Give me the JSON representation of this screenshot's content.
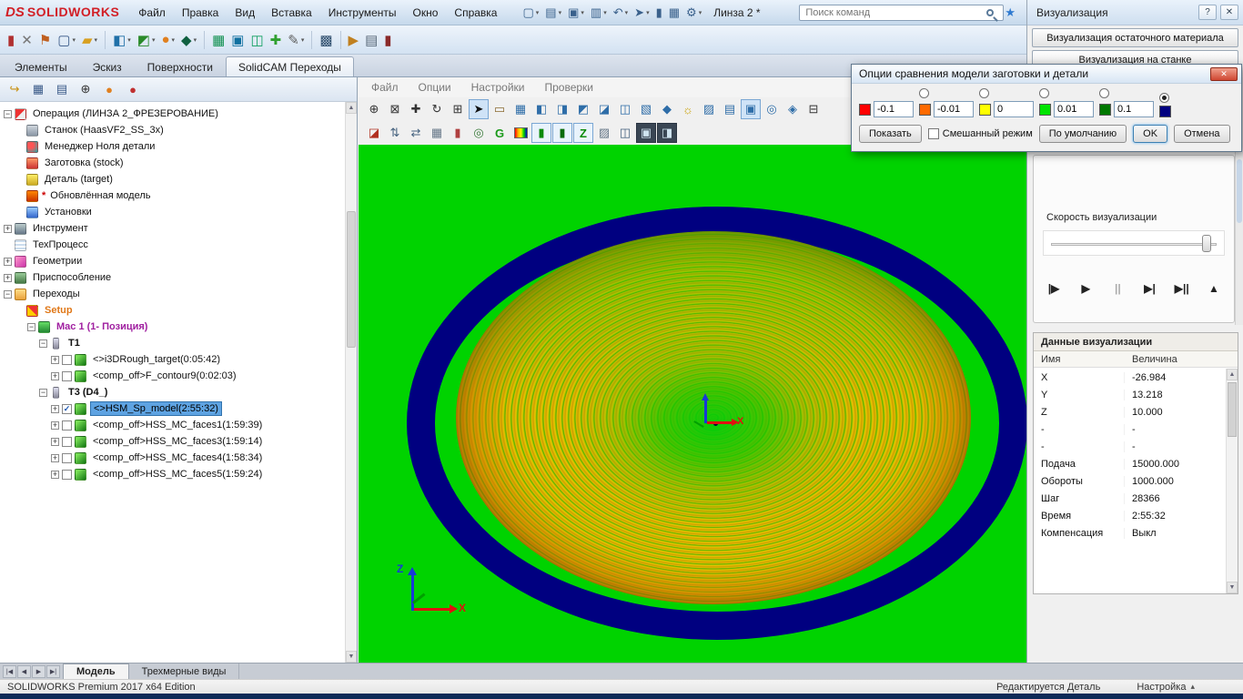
{
  "titlebar": {
    "logo_ds": "DS",
    "logo_text": "SOLIDWORKS",
    "doc_title": "Линза 2 *",
    "search_placeholder": "Поиск команд",
    "pin_icon": "★"
  },
  "menubar": [
    "Файл",
    "Правка",
    "Вид",
    "Вставка",
    "Инструменты",
    "Окно",
    "Справка"
  ],
  "quick_toolbar": [
    {
      "name": "new-document-icon",
      "glyph": "▢",
      "dd": true
    },
    {
      "name": "open-file-icon",
      "glyph": "▤",
      "dd": true
    },
    {
      "name": "save-icon",
      "glyph": "▣",
      "dd": true
    },
    {
      "name": "print-icon",
      "glyph": "▥",
      "dd": true
    },
    {
      "name": "undo-icon",
      "glyph": "↶",
      "dd": true
    },
    {
      "name": "select-cursor-icon",
      "glyph": "➤",
      "dd": true
    },
    {
      "name": "rebuild-icon",
      "glyph": "▮",
      "dd": false
    },
    {
      "name": "file-properties-icon",
      "glyph": "▦",
      "dd": false
    },
    {
      "name": "options-gear-icon",
      "glyph": "⚙",
      "dd": true
    }
  ],
  "solidcam_toolbar": [
    {
      "name": "solidcam-part-icon",
      "glyph": "▮",
      "color": "#b03030"
    },
    {
      "name": "close-part-icon",
      "glyph": "✕",
      "color": "#777777"
    },
    {
      "name": "save-cam-icon",
      "glyph": "⚑",
      "color": "#c06020"
    },
    {
      "name": "new-cam-document-icon",
      "glyph": "▢",
      "color": "#3a5a88",
      "dd": true
    },
    {
      "name": "open-cam-folder-icon",
      "glyph": "▰",
      "color": "#d8a020",
      "dd": true
    },
    {
      "sep": true
    },
    {
      "name": "mill-operation-icon",
      "glyph": "◧",
      "color": "#2070a8",
      "dd": true
    },
    {
      "name": "mill3d-operation-icon",
      "glyph": "◩",
      "color": "#2a8a2a",
      "dd": true
    },
    {
      "name": "drill-operation-icon",
      "glyph": "●",
      "color": "#e08020",
      "dd": true
    },
    {
      "name": "turn-operation-icon",
      "glyph": "◆",
      "color": "#106040",
      "dd": true
    },
    {
      "sep": true
    },
    {
      "name": "stock-definition-icon",
      "glyph": "▦",
      "color": "#109050"
    },
    {
      "name": "target-definition-icon",
      "glyph": "▣",
      "color": "#1070a0"
    },
    {
      "name": "machine-setup-icon",
      "glyph": "◫",
      "color": "#10a060"
    },
    {
      "name": "add-operation-icon",
      "glyph": "✚",
      "color": "#30a030"
    },
    {
      "name": "edit-operation-icon",
      "glyph": "✎",
      "color": "#606060",
      "dd": true
    },
    {
      "sep": true
    },
    {
      "name": "calculate-icon",
      "glyph": "▩",
      "color": "#2a4a6a"
    },
    {
      "sep": true
    },
    {
      "name": "simulate-icon",
      "glyph": "▶",
      "color": "#c08020"
    },
    {
      "name": "gcode-icon",
      "glyph": "▤",
      "color": "#5a6a7a"
    },
    {
      "name": "library-icon",
      "glyph": "▮",
      "color": "#8a2a2a"
    }
  ],
  "command_tabs": {
    "items": [
      "Элементы",
      "Эскиз",
      "Поверхности",
      "SolidCAM Переходы"
    ],
    "active_index": 3
  },
  "manager_toolbar": [
    {
      "name": "solidcam-manager-icon",
      "glyph": "↪",
      "color": "#c89010"
    },
    {
      "name": "operations-table-icon",
      "glyph": "▦",
      "color": "#3a5a88"
    },
    {
      "name": "document-structure-icon",
      "glyph": "▤",
      "color": "#3a5a88"
    },
    {
      "name": "coordinate-origin-icon",
      "glyph": "⊕",
      "color": "#333333"
    },
    {
      "name": "machine-preview-icon",
      "glyph": "●",
      "color": "#e08020"
    },
    {
      "name": "material-ic",
      "glyph": "●",
      "color": "#c03030"
    }
  ],
  "tree": {
    "items": [
      {
        "lvl": 0,
        "expand": "-",
        "icon": "operation",
        "text": "Операция (ЛИНЗА 2_ФРЕЗЕРОВАНИЕ)"
      },
      {
        "lvl": 1,
        "icon": "machine",
        "text": "Станок (HaasVF2_SS_3x)"
      },
      {
        "lvl": 1,
        "icon": "zero",
        "text": "Менеджер Ноля детали"
      },
      {
        "lvl": 1,
        "icon": "stock",
        "text": "Заготовка (stock)"
      },
      {
        "lvl": 1,
        "icon": "target",
        "text": "Деталь (target)"
      },
      {
        "lvl": 1,
        "icon": "updated",
        "text": "Обновлённая модель",
        "star": true
      },
      {
        "lvl": 1,
        "icon": "settings",
        "text": "Установки"
      },
      {
        "lvl": 0,
        "expand": "+",
        "icon": "tool",
        "text": "Инструмент"
      },
      {
        "lvl": 0,
        "icon": "process",
        "text": "ТехПроцесс"
      },
      {
        "lvl": 0,
        "expand": "+",
        "icon": "geometry",
        "text": "Геометрии"
      },
      {
        "lvl": 0,
        "expand": "+",
        "icon": "fixture",
        "text": "Приспособление"
      },
      {
        "lvl": 0,
        "expand": "-",
        "icon": "folder",
        "text": "Переходы"
      },
      {
        "lvl": 1,
        "icon": "setup",
        "text": "Setup",
        "color": "#e07818",
        "bold": true
      },
      {
        "lvl": 2,
        "expand": "-",
        "icon": "mac",
        "text": "Mac 1 (1- Позиция)",
        "color": "#a020a0",
        "bold": true
      },
      {
        "lvl": 3,
        "expand": "-",
        "icon": "toolbit",
        "text": "T1",
        "bold": true
      },
      {
        "lvl": 4,
        "expand": "+",
        "check": false,
        "icon": "op",
        "text": "<>i3DRough_target(0:05:42)"
      },
      {
        "lvl": 4,
        "expand": "+",
        "check": false,
        "icon": "op",
        "text": "<comp_off>F_contour9(0:02:03)"
      },
      {
        "lvl": 3,
        "expand": "-",
        "icon": "toolbit",
        "text": "T3  (D4_)",
        "bold": true
      },
      {
        "lvl": 4,
        "expand": "+",
        "check": true,
        "icon": "op",
        "text": "<>HSM_Sp_model(2:55:32)",
        "sel": true
      },
      {
        "lvl": 4,
        "expand": "+",
        "check": false,
        "icon": "op",
        "text": "<comp_off>HSS_MC_faces1(1:59:39)"
      },
      {
        "lvl": 4,
        "expand": "+",
        "check": false,
        "icon": "op",
        "text": "<comp_off>HSS_MC_faces3(1:59:14)"
      },
      {
        "lvl": 4,
        "expand": "+",
        "check": false,
        "icon": "op",
        "text": "<comp_off>HSS_MC_faces4(1:58:34)"
      },
      {
        "lvl": 4,
        "expand": "+",
        "check": false,
        "icon": "op",
        "text": "<comp_off>HSS_MC_faces5(1:59:24)"
      }
    ]
  },
  "sim": {
    "menus": [
      "Файл",
      "Опции",
      "Настройки",
      "Проверки"
    ],
    "axis": {
      "x": "X",
      "z": "Z"
    },
    "toolbar1": [
      {
        "name": "zoom-fit-icon",
        "glyph": "⊕",
        "color": "#333333"
      },
      {
        "name": "zoom-window-icon",
        "glyph": "⊠",
        "color": "#333333"
      },
      {
        "name": "pan-icon",
        "glyph": "✚",
        "color": "#333333"
      },
      {
        "name": "rotate-view-icon",
        "glyph": "↻",
        "color": "#333333"
      },
      {
        "name": "zoom-select-icon",
        "glyph": "⊞",
        "color": "#333333"
      },
      {
        "name": "select-arrow-icon",
        "glyph": "➤",
        "color": "#111111",
        "pressed": true
      },
      {
        "name": "measure-icon",
        "glyph": "▭",
        "color": "#8a6a30"
      },
      {
        "name": "section-view-icon",
        "glyph": "▦",
        "color": "#2e6da8"
      },
      {
        "name": "view-front-icon",
        "glyph": "◧",
        "color": "#2e6da8"
      },
      {
        "name": "view-back-icon",
        "glyph": "◨",
        "color": "#2e6da8"
      },
      {
        "name": "view-left-icon",
        "glyph": "◩",
        "color": "#2e6da8"
      },
      {
        "name": "view-right-icon",
        "glyph": "◪",
        "color": "#2e6da8"
      },
      {
        "name": "view-top-icon",
        "glyph": "◫",
        "color": "#2e6da8"
      },
      {
        "name": "view-bottom-icon",
        "glyph": "▧",
        "color": "#2e6da8"
      },
      {
        "name": "view-iso-icon",
        "glyph": "◆",
        "color": "#2e6da8"
      },
      {
        "name": "light-icon",
        "glyph": "☼",
        "color": "#c8a000"
      },
      {
        "name": "view-cube-a-icon",
        "glyph": "▨",
        "color": "#2e6da8"
      },
      {
        "name": "view-cube-b-icon",
        "glyph": "▤",
        "color": "#2e6da8"
      },
      {
        "name": "shaded-view-icon",
        "glyph": "▣",
        "color": "#2e6da8",
        "pressed": true
      },
      {
        "name": "wireframe-view-icon",
        "glyph": "◎",
        "color": "#2e6da8"
      },
      {
        "name": "compare-view-icon",
        "glyph": "◈",
        "color": "#2e6da8"
      },
      {
        "name": "fullscreen-icon",
        "glyph": "⊟",
        "color": "#333333"
      }
    ],
    "toolbar2": [
      {
        "name": "sim-mode-icon",
        "glyph": "◪",
        "color": "#b03020"
      },
      {
        "name": "step-up-icon",
        "glyph": "⇅",
        "color": "#44617e"
      },
      {
        "name": "step-through-icon",
        "glyph": "⇄",
        "color": "#44617e"
      },
      {
        "name": "grid-icon",
        "glyph": "▦",
        "color": "#667788"
      },
      {
        "name": "tool-display-icon",
        "glyph": "▮",
        "color": "#b04040"
      },
      {
        "name": "gouge-check-icon",
        "glyph": "◎",
        "color": "#3a7a3a"
      },
      {
        "name": "gcode-view-icon",
        "glyph": "G",
        "color": "#1a9a1a",
        "bold": true
      },
      {
        "name": "color-scale-icon",
        "rainbow": true
      },
      {
        "name": "stock-compare-icon",
        "glyph": "▮",
        "color": "#0a8a0a",
        "framed": true
      },
      {
        "name": "target-compare-icon",
        "glyph": "▮",
        "color": "#0a6a0a",
        "framed": true
      },
      {
        "name": "z-levels-icon",
        "glyph": "Z",
        "color": "#0a8a0a",
        "bold": true,
        "framed": true
      },
      {
        "name": "report-icon",
        "glyph": "▨",
        "color": "#667788"
      },
      {
        "name": "snapshot-icon",
        "glyph": "◫",
        "color": "#44617e"
      },
      {
        "name": "capture-image-icon",
        "glyph": "▣",
        "color": "#cfe3ef",
        "dark": true
      },
      {
        "name": "record-video-icon",
        "glyph": "◨",
        "color": "#cfe3ef",
        "dark": true
      }
    ]
  },
  "visual_panel": {
    "title": "Визуализация",
    "help_icon": "?",
    "close_icon": "✕",
    "buttons": [
      "Визуализация остаточного материала",
      "Визуализация на станке"
    ],
    "speed_label": "Скорость визуализации",
    "playback": [
      {
        "name": "play-to-start-button",
        "glyph": "|▶"
      },
      {
        "name": "play-button",
        "glyph": "▶"
      },
      {
        "name": "pause-button",
        "glyph": "||",
        "disabled": true
      },
      {
        "name": "play-to-end-button",
        "glyph": "▶|"
      },
      {
        "name": "fast-forward-button",
        "glyph": "▶||"
      },
      {
        "name": "eject-button",
        "glyph": "▲"
      }
    ]
  },
  "dialog": {
    "title": "Опции сравнения модели заготовки и детали",
    "close_icon": "✕",
    "groups": [
      {
        "color": "#ff0000",
        "value": "-0.1"
      },
      {
        "color": "#ff6a00",
        "value": "-0.01",
        "radio": true
      },
      {
        "color": "#ffff00",
        "value": "0",
        "radio": true
      },
      {
        "color": "#00e400",
        "value": "0.01",
        "radio": true
      },
      {
        "color": "#007800",
        "value": "0.1",
        "radio": true
      },
      {
        "color": "#000080",
        "radio": true,
        "radio_checked": true
      }
    ],
    "show_btn": "Показать",
    "mixed_label": "Смешанный режим",
    "default_btn": "По умолчанию",
    "ok": "OK",
    "cancel": "Отмена"
  },
  "data_panel": {
    "title": "Данные визуализации",
    "headers": [
      "Имя",
      "Величина"
    ],
    "rows": [
      [
        "X",
        "-26.984"
      ],
      [
        "Y",
        "13.218"
      ],
      [
        "Z",
        "10.000"
      ],
      [
        "-",
        "-"
      ],
      [
        "-",
        "-"
      ],
      [
        "Подача",
        "15000.000"
      ],
      [
        "Обороты",
        "1000.000"
      ],
      [
        "Шаг",
        "28366"
      ],
      [
        "Время",
        "2:55:32"
      ],
      [
        "Компенсация",
        "Выкл"
      ]
    ]
  },
  "bottom": {
    "nav": [
      "|◀",
      "◀",
      "▶",
      "▶|"
    ],
    "tabs": [
      "Модель",
      "Трехмерные виды"
    ],
    "active_index": 0
  },
  "statusbar": {
    "left": "SOLIDWORKS Premium 2017 x64 Edition",
    "edit": "Редактируется Деталь",
    "mode": "Настройка",
    "chevron": "▴"
  },
  "colors": {
    "viewport_green": "#00d300",
    "stock_navy": "#000080",
    "surface_yellow": "#e2be00"
  }
}
